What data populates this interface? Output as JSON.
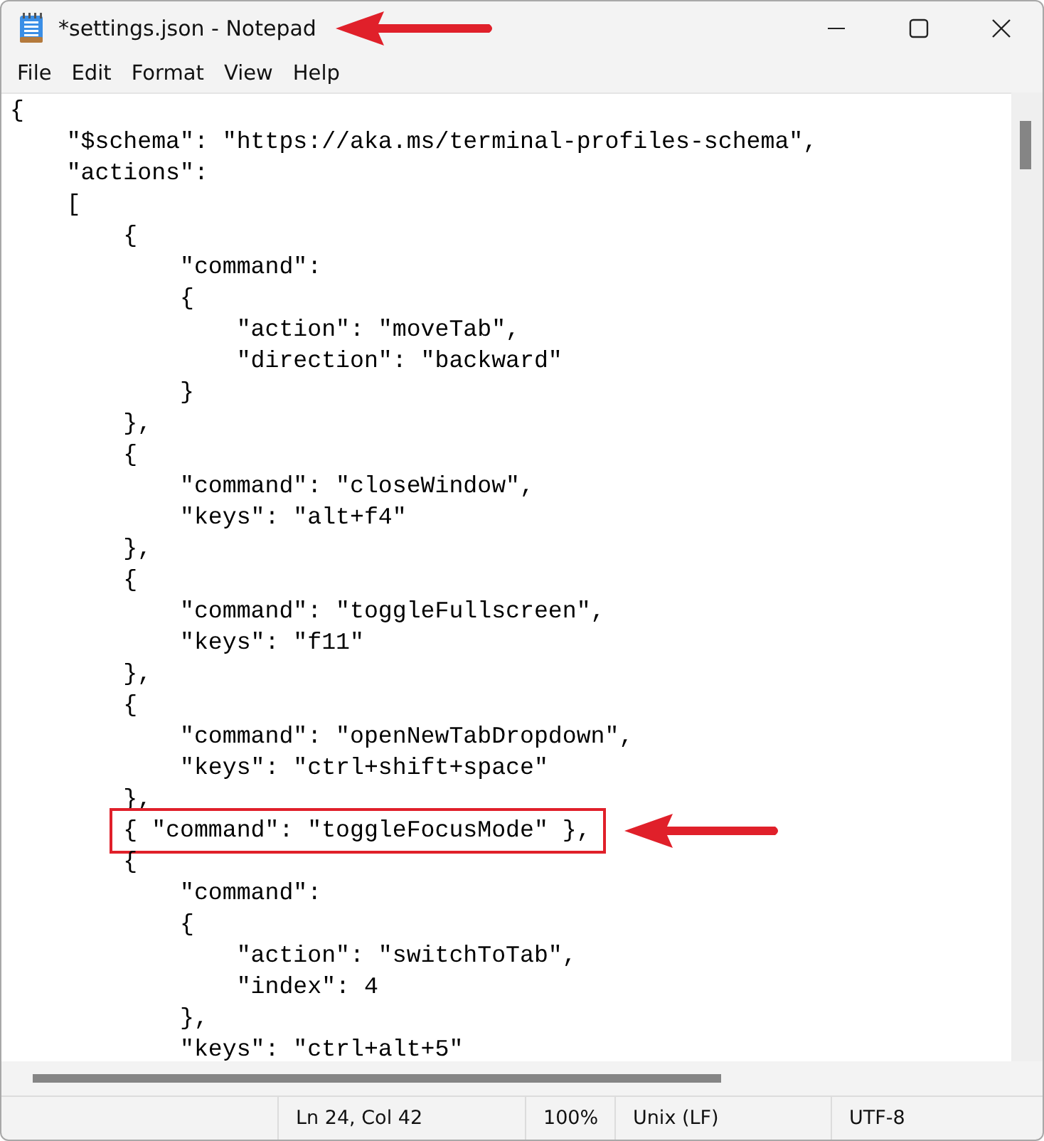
{
  "window": {
    "title": "*settings.json - Notepad",
    "title_callout": true
  },
  "menu": [
    "File",
    "Edit",
    "Format",
    "View",
    "Help"
  ],
  "lines": [
    {
      "text": "{",
      "highlighted": false
    },
    {
      "text": "    \"$schema\": \"https://aka.ms/terminal-profiles-schema\",",
      "highlighted": false
    },
    {
      "text": "    \"actions\":",
      "highlighted": false
    },
    {
      "text": "    [",
      "highlighted": false
    },
    {
      "text": "        {",
      "highlighted": false
    },
    {
      "text": "            \"command\":",
      "highlighted": false
    },
    {
      "text": "            {",
      "highlighted": false
    },
    {
      "text": "                \"action\": \"moveTab\",",
      "highlighted": false
    },
    {
      "text": "                \"direction\": \"backward\"",
      "highlighted": false
    },
    {
      "text": "            }",
      "highlighted": false
    },
    {
      "text": "        },",
      "highlighted": false
    },
    {
      "text": "        {",
      "highlighted": false
    },
    {
      "text": "            \"command\": \"closeWindow\",",
      "highlighted": false
    },
    {
      "text": "            \"keys\": \"alt+f4\"",
      "highlighted": false
    },
    {
      "text": "        },",
      "highlighted": false
    },
    {
      "text": "        {",
      "highlighted": false
    },
    {
      "text": "            \"command\": \"toggleFullscreen\",",
      "highlighted": false
    },
    {
      "text": "            \"keys\": \"f11\"",
      "highlighted": false
    },
    {
      "text": "        },",
      "highlighted": false
    },
    {
      "text": "        {",
      "highlighted": false
    },
    {
      "text": "            \"command\": \"openNewTabDropdown\",",
      "highlighted": false
    },
    {
      "text": "            \"keys\": \"ctrl+shift+space\"",
      "highlighted": false
    },
    {
      "text": "        },",
      "highlighted": false
    },
    {
      "text": "        { \"command\": \"toggleFocusMode\" },",
      "highlighted": true
    },
    {
      "text": "        {",
      "highlighted": false
    },
    {
      "text": "            \"command\":",
      "highlighted": false
    },
    {
      "text": "            {",
      "highlighted": false
    },
    {
      "text": "                \"action\": \"switchToTab\",",
      "highlighted": false
    },
    {
      "text": "                \"index\": 4",
      "highlighted": false
    },
    {
      "text": "            },",
      "highlighted": false
    },
    {
      "text": "            \"keys\": \"ctrl+alt+5\"",
      "highlighted": false
    }
  ],
  "status_bar": [
    "Ln 24, Col 42",
    "100%",
    "Unix (LF)",
    "UTF-8"
  ]
}
